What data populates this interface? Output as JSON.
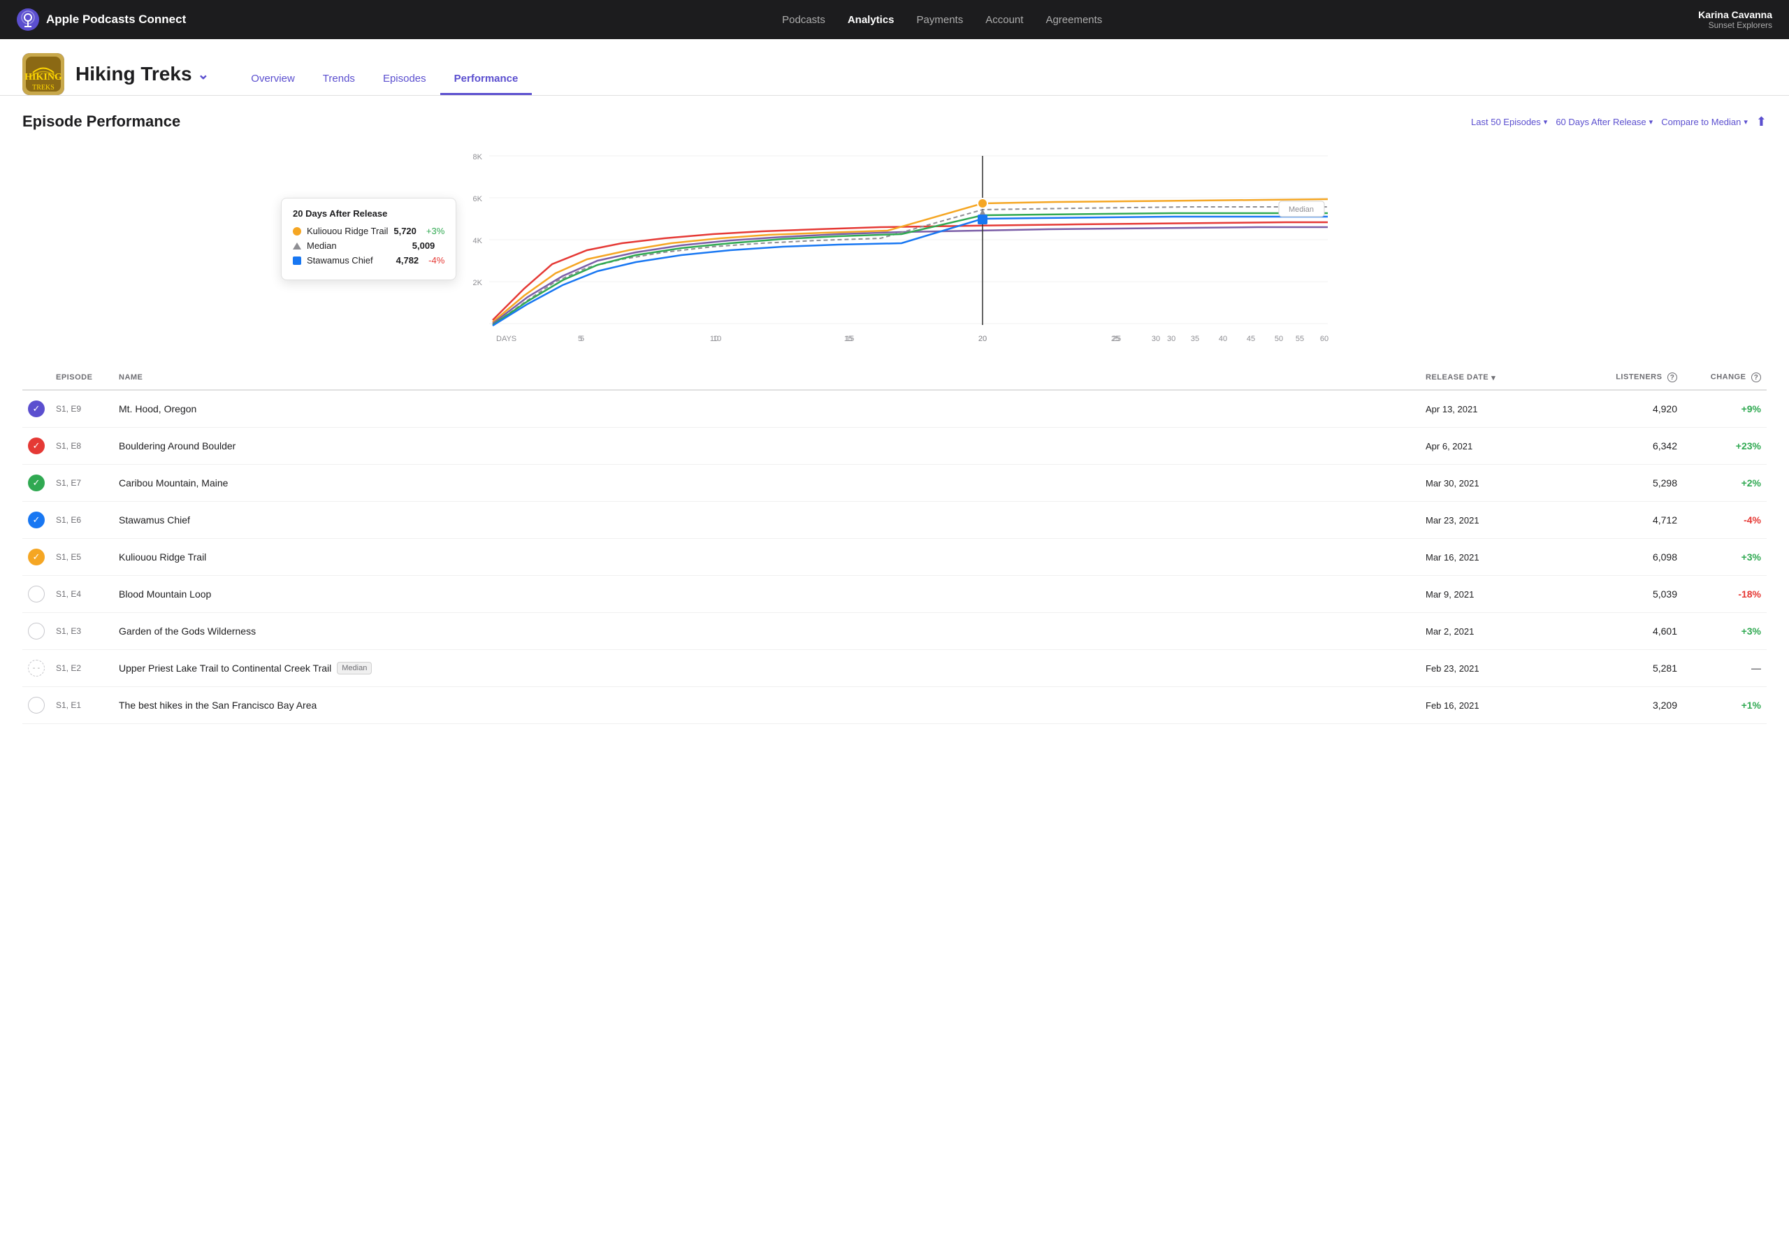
{
  "app": {
    "title": "Apple Podcasts Connect"
  },
  "header": {
    "nav": [
      {
        "label": "Podcasts",
        "active": false
      },
      {
        "label": "Analytics",
        "active": true
      },
      {
        "label": "Payments",
        "active": false
      },
      {
        "label": "Account",
        "active": false
      },
      {
        "label": "Agreements",
        "active": false
      }
    ],
    "user": {
      "name": "Karina Cavanna",
      "podcast": "Sunset Explorers"
    }
  },
  "podcast": {
    "name": "Hiking Treks",
    "tabs": [
      {
        "label": "Overview",
        "active": false
      },
      {
        "label": "Trends",
        "active": false
      },
      {
        "label": "Episodes",
        "active": false
      },
      {
        "label": "Performance",
        "active": true
      }
    ]
  },
  "performance": {
    "title": "Episode Performance",
    "filters": {
      "episodes": "Last 50 Episodes",
      "days": "60 Days After Release",
      "compare": "Compare to Median"
    }
  },
  "chart": {
    "yLabels": [
      "8K",
      "6K",
      "4K",
      "2K"
    ],
    "xLabels": [
      "DAYS",
      "5",
      "10",
      "15",
      "20",
      "25",
      "30",
      "35",
      "40",
      "45",
      "50",
      "55",
      "60"
    ],
    "medianLabel": "Median",
    "tooltip": {
      "title": "20 Days After Release",
      "rows": [
        {
          "type": "circle",
          "color": "#f5a623",
          "label": "Kuliouou Ridge Trail",
          "value": "5,720",
          "change": "+3%",
          "changeType": "pos"
        },
        {
          "type": "triangle",
          "color": "#8e8e93",
          "label": "Median",
          "value": "5,009",
          "change": "",
          "changeType": ""
        },
        {
          "type": "square",
          "color": "#1877f2",
          "label": "Stawamus Chief",
          "value": "4,782",
          "change": "-4%",
          "changeType": "neg"
        }
      ]
    }
  },
  "table": {
    "columns": [
      "",
      "EPISODE",
      "NAME",
      "RELEASE DATE",
      "LISTENERS",
      "CHANGE"
    ],
    "rows": [
      {
        "badgeType": "purple",
        "badgeIcon": "✓",
        "episode": "S1, E9",
        "name": "Mt. Hood, Oregon",
        "isMedian": false,
        "releaseDate": "Apr 13, 2021",
        "listeners": "4,920",
        "change": "+9%",
        "changeType": "pos"
      },
      {
        "badgeType": "red",
        "badgeIcon": "✓",
        "episode": "S1, E8",
        "name": "Bouldering Around Boulder",
        "isMedian": false,
        "releaseDate": "Apr 6, 2021",
        "listeners": "6,342",
        "change": "+23%",
        "changeType": "pos"
      },
      {
        "badgeType": "green",
        "badgeIcon": "✓",
        "episode": "S1, E7",
        "name": "Caribou Mountain, Maine",
        "isMedian": false,
        "releaseDate": "Mar 30, 2021",
        "listeners": "5,298",
        "change": "+2%",
        "changeType": "pos"
      },
      {
        "badgeType": "blue",
        "badgeIcon": "✓",
        "episode": "S1, E6",
        "name": "Stawamus Chief",
        "isMedian": false,
        "releaseDate": "Mar 23, 2021",
        "listeners": "4,712",
        "change": "-4%",
        "changeType": "neg"
      },
      {
        "badgeType": "orange",
        "badgeIcon": "✓",
        "episode": "S1, E5",
        "name": "Kuliouou Ridge Trail",
        "isMedian": false,
        "releaseDate": "Mar 16, 2021",
        "listeners": "6,098",
        "change": "+3%",
        "changeType": "pos"
      },
      {
        "badgeType": "empty",
        "badgeIcon": "",
        "episode": "S1, E4",
        "name": "Blood Mountain Loop",
        "isMedian": false,
        "releaseDate": "Mar 9, 2021",
        "listeners": "5,039",
        "change": "-18%",
        "changeType": "neg"
      },
      {
        "badgeType": "empty",
        "badgeIcon": "",
        "episode": "S1, E3",
        "name": "Garden of the Gods Wilderness",
        "isMedian": false,
        "releaseDate": "Mar 2, 2021",
        "listeners": "4,601",
        "change": "+3%",
        "changeType": "pos"
      },
      {
        "badgeType": "dashed",
        "badgeIcon": "",
        "episode": "S1, E2",
        "name": "Upper Priest Lake Trail to Continental Creek Trail",
        "isMedian": true,
        "releaseDate": "Feb 23, 2021",
        "listeners": "5,281",
        "change": "—",
        "changeType": "neutral"
      },
      {
        "badgeType": "empty",
        "badgeIcon": "",
        "episode": "S1, E1",
        "name": "The best hikes in the San Francisco Bay Area",
        "isMedian": false,
        "releaseDate": "Feb 16, 2021",
        "listeners": "3,209",
        "change": "+1%",
        "changeType": "pos"
      }
    ]
  }
}
